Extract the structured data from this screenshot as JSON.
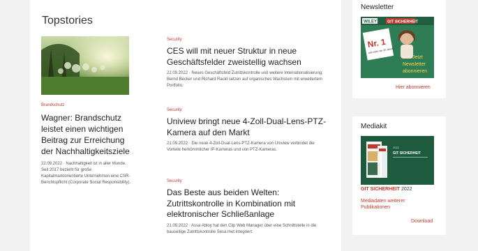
{
  "main": {
    "title": "Topstories",
    "feature": {
      "category": "Brandschutz",
      "headline": "Wagner: Brandschutz leistet einen wichtigen Beitrag zur Erreichung der Nachhaltigkeitsziele",
      "meta": "22.09.2022 · Nachhaltigkeit ist in aller Munde. Seit 2017 bezieht für große Kapitalmarktorientierte Unternehmen eine CSR-Berichtspflicht (Corporate Social Responsibility)."
    },
    "articles": [
      {
        "category": "Security",
        "headline": "CES will mit neuer Struktur in neue Geschäftsfelder zweistellig wachsen",
        "meta": "22.09.2022 · Neues Geschäftsfeld Zutrittskontrolle und weitere Internationalisierung: Bernd Becker und Richard Rackl setzen auf organisches Wachstum mit erweitertem Portfolio."
      },
      {
        "category": "Security",
        "headline": "Uniview bringt neue 4-Zoll-Dual-Lens-PTZ-Kamera auf den Markt",
        "meta": "21.09.2022 · Die neue 4-Zoll-Dual-Lens-PTZ-Kamera von Uniview verbindet die Vorteile herkömmlicher IP-Kameras und von PTZ-Kameras."
      },
      {
        "category": "Security",
        "headline": "Das Beste aus beiden Welten: Zutrittskontrolle in Kombination mit elektronischer Schließanlage",
        "meta": "21.09.2022 · Assa Abloy hat den Clip Web Manager über eine Schnittstelle in die bauseitige Zutrittskontrolle Sesa met integriert."
      }
    ]
  },
  "newsletter": {
    "title": "Newsletter",
    "banner": {
      "publisher": "WILEY",
      "brand": "GIT SICHERHEIT",
      "rank": "Nr. 1",
      "rank_sub": "seit mehr als 30 Jahren",
      "cta_line1": "Jetzt",
      "cta_line2": "Newsletter",
      "cta_line3": "abonnieren"
    },
    "link": "Hier abonnieren"
  },
  "mediakit": {
    "title": "Mediakit",
    "banner": {
      "heading": "GIT SICHERHEIT",
      "year": "2022"
    },
    "caption_brand": "GIT SICHERHEIT",
    "caption_year": "2022",
    "link_publications": "Mediadaten weiterer Publikationen",
    "link_download": "Download"
  },
  "colors": {
    "accent_red": "#c0392b",
    "newsletter_green": "#2e7d55",
    "mediakit_green": "#1d5a3e"
  }
}
